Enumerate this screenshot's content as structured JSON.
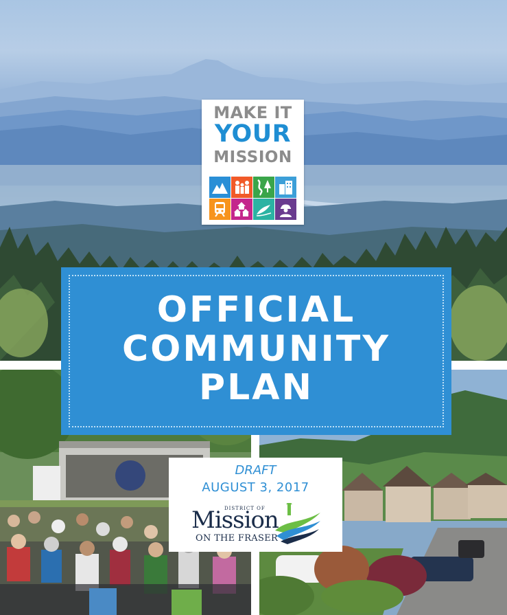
{
  "logo": {
    "line1": "MAKE IT",
    "line2": "YOUR",
    "line3": "MISSION",
    "tiles": [
      {
        "icon": "mountains-icon",
        "color": "#2a8fd6"
      },
      {
        "icon": "family-icon",
        "color": "#f15a29"
      },
      {
        "icon": "river-trees-icon",
        "color": "#3aa54a"
      },
      {
        "icon": "buildings-icon",
        "color": "#3c9fd8"
      },
      {
        "icon": "train-icon",
        "color": "#f7941d"
      },
      {
        "icon": "houses-icon",
        "color": "#c4278c"
      },
      {
        "icon": "fish-icon",
        "color": "#2bb3a3"
      },
      {
        "icon": "worker-icon",
        "color": "#6a3b8f"
      }
    ]
  },
  "title": {
    "line1": "OFFICIAL",
    "line2": "COMMUNITY",
    "line3": "PLAN"
  },
  "draft": {
    "label": "DRAFT",
    "date": "AUGUST 3, 2017"
  },
  "district": {
    "small": "DISTRICT OF",
    "name": "Mission",
    "sub": "ON THE FRASER"
  },
  "colors": {
    "brand_blue": "#2f8fd4",
    "logo_grey": "#8c8c8c",
    "logo_blue": "#1f8ed3",
    "district_navy": "#1b2d4a",
    "district_green": "#6cbe45"
  }
}
